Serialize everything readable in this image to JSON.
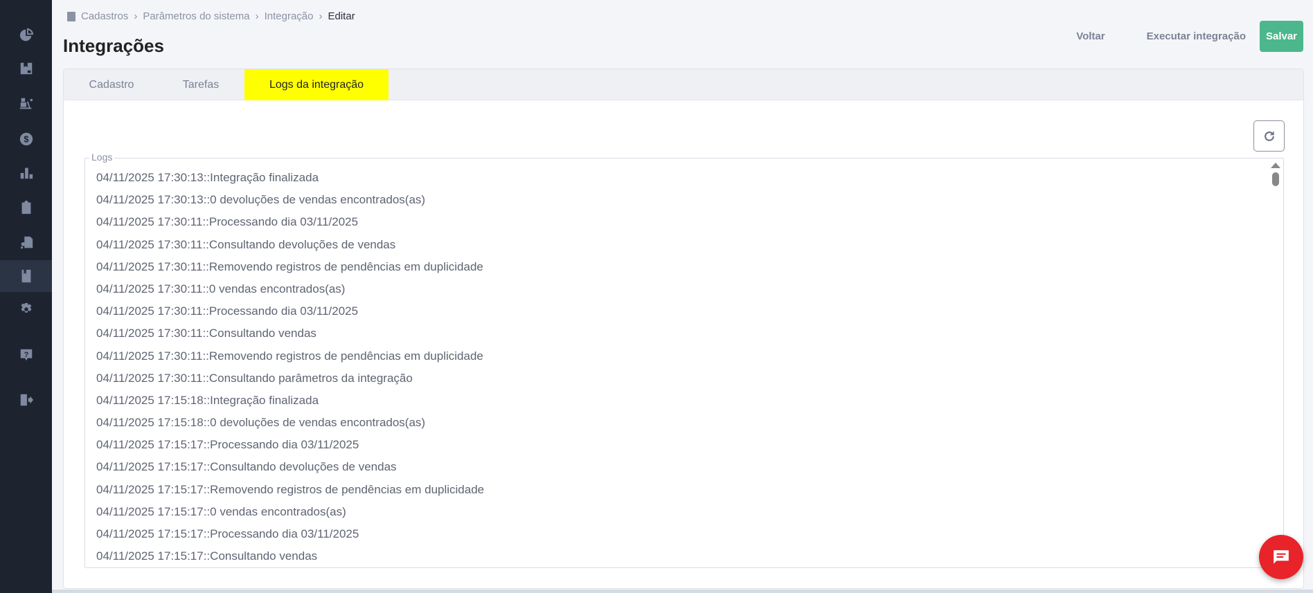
{
  "sidebar": {
    "items": [
      "dashboard",
      "cadastros-box",
      "logistica",
      "financeiro",
      "relatorios",
      "clipboard",
      "certificados",
      "cadastros",
      "configuracoes",
      "ajuda",
      "sair"
    ],
    "active": "cadastros"
  },
  "breadcrumb": {
    "items": [
      "Cadastros",
      "Parâmetros do sistema",
      "Integração"
    ],
    "current": "Editar"
  },
  "page": {
    "title": "Integrações"
  },
  "actions": {
    "back": "Voltar",
    "run": "Executar integração",
    "save": "Salvar"
  },
  "colors": {
    "accent": "#4cb68c",
    "active_tab": "#ffff00",
    "chat": "#e8232a",
    "sidebar": "#1e2330"
  },
  "tabs": [
    {
      "label": "Cadastro"
    },
    {
      "label": "Tarefas"
    },
    {
      "label": "Logs da integração",
      "active": true
    }
  ],
  "logs": {
    "legend": "Logs",
    "lines": [
      "04/11/2025 17:30:13::Integração finalizada",
      "04/11/2025 17:30:13::0 devoluções de vendas encontrados(as)",
      "04/11/2025 17:30:11::Processando dia 03/11/2025",
      "04/11/2025 17:30:11::Consultando devoluções de vendas",
      "04/11/2025 17:30:11::Removendo registros de pendências em duplicidade",
      "04/11/2025 17:30:11::0 vendas encontrados(as)",
      "04/11/2025 17:30:11::Processando dia 03/11/2025",
      "04/11/2025 17:30:11::Consultando vendas",
      "04/11/2025 17:30:11::Removendo registros de pendências em duplicidade",
      "04/11/2025 17:30:11::Consultando parâmetros da integração",
      "04/11/2025 17:15:18::Integração finalizada",
      "04/11/2025 17:15:18::0 devoluções de vendas encontrados(as)",
      "04/11/2025 17:15:17::Processando dia 03/11/2025",
      "04/11/2025 17:15:17::Consultando devoluções de vendas",
      "04/11/2025 17:15:17::Removendo registros de pendências em duplicidade",
      "04/11/2025 17:15:17::0 vendas encontrados(as)",
      "04/11/2025 17:15:17::Processando dia 03/11/2025",
      "04/11/2025 17:15:17::Consultando vendas"
    ]
  }
}
